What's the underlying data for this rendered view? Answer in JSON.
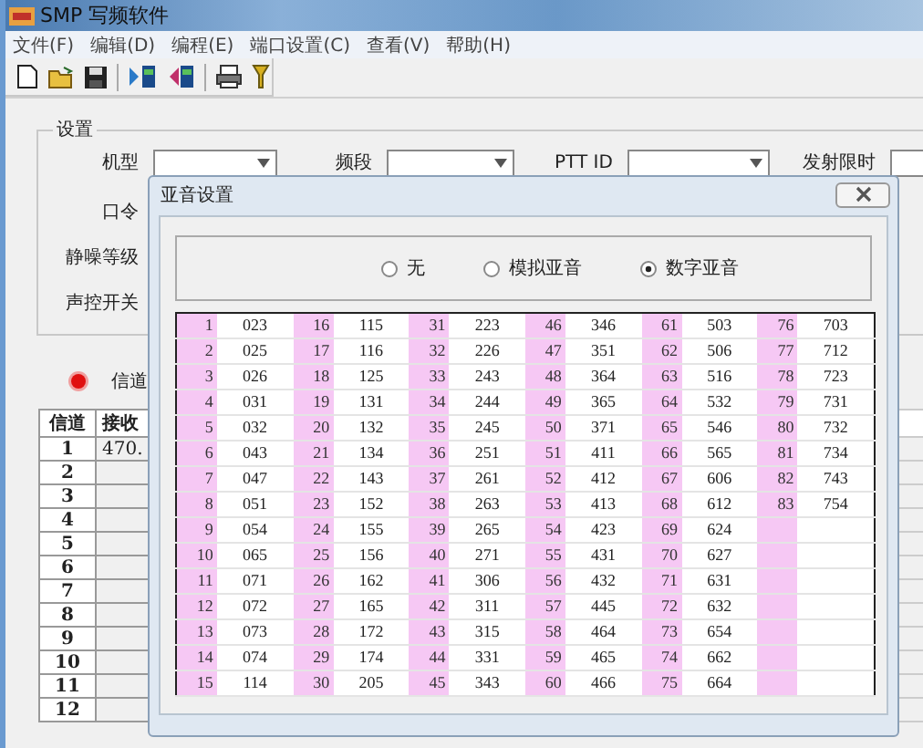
{
  "window": {
    "title": "SMP 写频软件"
  },
  "menu": [
    "文件(F)",
    "编辑(D)",
    "编程(E)",
    "端口设置(C)",
    "查看(V)",
    "帮助(H)"
  ],
  "settings": {
    "title": "设置",
    "top_fields": [
      {
        "label": "机型"
      },
      {
        "label": "频段"
      },
      {
        "label": "PTT ID"
      },
      {
        "label": "发射限时"
      }
    ],
    "labels": [
      "口令",
      "静噪等级",
      "声控开关"
    ]
  },
  "status": {
    "label": "信道"
  },
  "channel_table": {
    "columns": [
      "信道",
      "接收"
    ],
    "rows": [
      {
        "channel": "1",
        "receive": "470."
      },
      {
        "channel": "2"
      },
      {
        "channel": "3"
      },
      {
        "channel": "4"
      },
      {
        "channel": "5"
      },
      {
        "channel": "6"
      },
      {
        "channel": "7"
      },
      {
        "channel": "8"
      },
      {
        "channel": "9"
      },
      {
        "channel": "10"
      },
      {
        "channel": "11"
      },
      {
        "channel": "12"
      }
    ]
  },
  "dialog": {
    "title": "亚音设置",
    "options": [
      {
        "label": "无",
        "selected": false
      },
      {
        "label": "模拟亚音",
        "selected": false
      },
      {
        "label": "数字亚音",
        "selected": true
      }
    ],
    "columns": [
      {
        "entries": [
          [
            "1",
            "023"
          ],
          [
            "2",
            "025"
          ],
          [
            "3",
            "026"
          ],
          [
            "4",
            "031"
          ],
          [
            "5",
            "032"
          ],
          [
            "6",
            "043"
          ],
          [
            "7",
            "047"
          ],
          [
            "8",
            "051"
          ],
          [
            "9",
            "054"
          ],
          [
            "10",
            "065"
          ],
          [
            "11",
            "071"
          ],
          [
            "12",
            "072"
          ],
          [
            "13",
            "073"
          ],
          [
            "14",
            "074"
          ],
          [
            "15",
            "114"
          ]
        ]
      },
      {
        "entries": [
          [
            "16",
            "115"
          ],
          [
            "17",
            "116"
          ],
          [
            "18",
            "125"
          ],
          [
            "19",
            "131"
          ],
          [
            "20",
            "132"
          ],
          [
            "21",
            "134"
          ],
          [
            "22",
            "143"
          ],
          [
            "23",
            "152"
          ],
          [
            "24",
            "155"
          ],
          [
            "25",
            "156"
          ],
          [
            "26",
            "162"
          ],
          [
            "27",
            "165"
          ],
          [
            "28",
            "172"
          ],
          [
            "29",
            "174"
          ],
          [
            "30",
            "205"
          ]
        ]
      },
      {
        "entries": [
          [
            "31",
            "223"
          ],
          [
            "32",
            "226"
          ],
          [
            "33",
            "243"
          ],
          [
            "34",
            "244"
          ],
          [
            "35",
            "245"
          ],
          [
            "36",
            "251"
          ],
          [
            "37",
            "261"
          ],
          [
            "38",
            "263"
          ],
          [
            "39",
            "265"
          ],
          [
            "40",
            "271"
          ],
          [
            "41",
            "306"
          ],
          [
            "42",
            "311"
          ],
          [
            "43",
            "315"
          ],
          [
            "44",
            "331"
          ],
          [
            "45",
            "343"
          ]
        ]
      },
      {
        "entries": [
          [
            "46",
            "346"
          ],
          [
            "47",
            "351"
          ],
          [
            "48",
            "364"
          ],
          [
            "49",
            "365"
          ],
          [
            "50",
            "371"
          ],
          [
            "51",
            "411"
          ],
          [
            "52",
            "412"
          ],
          [
            "53",
            "413"
          ],
          [
            "54",
            "423"
          ],
          [
            "55",
            "431"
          ],
          [
            "56",
            "432"
          ],
          [
            "57",
            "445"
          ],
          [
            "58",
            "464"
          ],
          [
            "59",
            "465"
          ],
          [
            "60",
            "466"
          ]
        ]
      },
      {
        "entries": [
          [
            "61",
            "503"
          ],
          [
            "62",
            "506"
          ],
          [
            "63",
            "516"
          ],
          [
            "64",
            "532"
          ],
          [
            "65",
            "546"
          ],
          [
            "66",
            "565"
          ],
          [
            "67",
            "606"
          ],
          [
            "68",
            "612"
          ],
          [
            "69",
            "624"
          ],
          [
            "70",
            "627"
          ],
          [
            "71",
            "631"
          ],
          [
            "72",
            "632"
          ],
          [
            "73",
            "654"
          ],
          [
            "74",
            "662"
          ],
          [
            "75",
            "664"
          ]
        ]
      },
      {
        "entries": [
          [
            "76",
            "703"
          ],
          [
            "77",
            "712"
          ],
          [
            "78",
            "723"
          ],
          [
            "79",
            "731"
          ],
          [
            "80",
            "732"
          ],
          [
            "81",
            "734"
          ],
          [
            "82",
            "743"
          ],
          [
            "83",
            "754"
          ]
        ]
      }
    ]
  }
}
